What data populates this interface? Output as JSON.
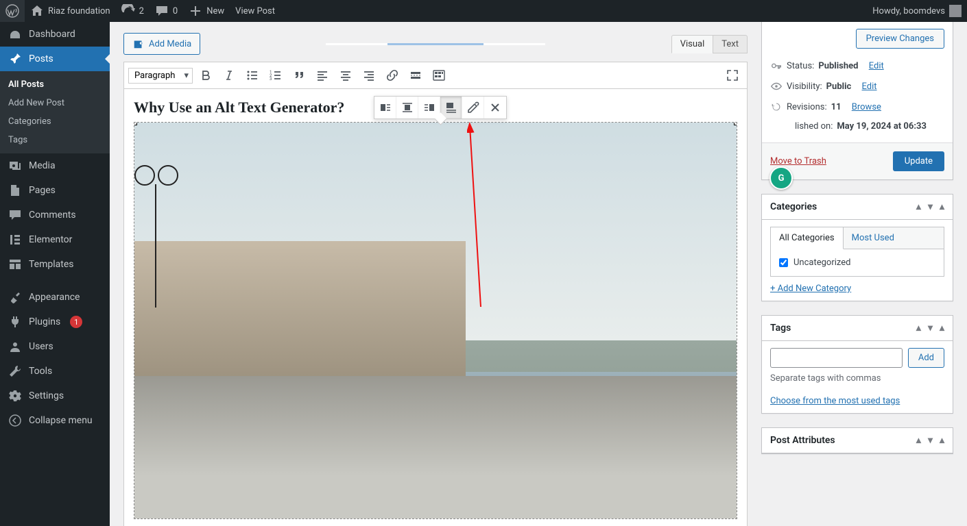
{
  "adminbar": {
    "site": "Riaz foundation",
    "refresh": "2",
    "comments": "0",
    "new": "New",
    "viewpost": "View Post",
    "howdy": "Howdy, boomdevs"
  },
  "sidemenu": {
    "dashboard": "Dashboard",
    "posts": "Posts",
    "all_posts": "All Posts",
    "add_new": "Add New Post",
    "categories": "Categories",
    "tags": "Tags",
    "media": "Media",
    "pages": "Pages",
    "comments": "Comments",
    "elementor": "Elementor",
    "templates": "Templates",
    "appearance": "Appearance",
    "plugins": "Plugins",
    "plugins_count": "1",
    "users": "Users",
    "tools": "Tools",
    "settings": "Settings",
    "collapse": "Collapse menu"
  },
  "editor": {
    "add_media": "Add Media",
    "tabs": {
      "visual": "Visual",
      "text": "Text"
    },
    "format_value": "Paragraph",
    "heading": "Why Use an Alt Text Generator?"
  },
  "publish": {
    "preview": "Preview Changes",
    "status_label": "Status:",
    "status_value": "Published",
    "status_edit": "Edit",
    "visibility_label": "Visibility:",
    "visibility_value": "Public",
    "visibility_edit": "Edit",
    "revisions_label": "Revisions:",
    "revisions_value": "11",
    "revisions_browse": "Browse",
    "published_label": "lished on:",
    "published_value": "May 19, 2024 at 06:33",
    "trash": "Move to Trash",
    "update": "Update"
  },
  "categories": {
    "title": "Categories",
    "tab_all": "All Categories",
    "tab_most": "Most Used",
    "uncategorized": "Uncategorized",
    "add_new": "+ Add New Category"
  },
  "tags": {
    "title": "Tags",
    "add": "Add",
    "help": "Separate tags with commas",
    "choose": "Choose from the most used tags"
  },
  "attributes": {
    "title": "Post Attributes"
  }
}
